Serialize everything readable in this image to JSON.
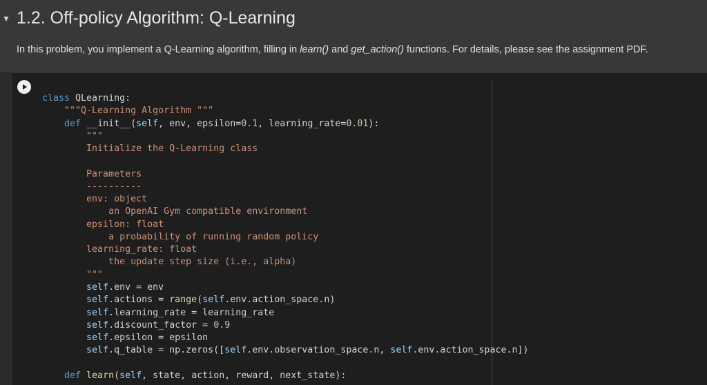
{
  "section": {
    "title": "1.2. Off-policy Algorithm: Q-Learning",
    "desc_parts": [
      "In this problem, you implement a Q-Learning algorithm, filling in ",
      "learn()",
      " and ",
      "get_action()",
      " functions. For details, please see the assignment PDF."
    ]
  },
  "colors": {
    "keyword": "#569cd6",
    "string": "#ce9178",
    "self": "#9cdcfe",
    "number": "#b5cea8",
    "function": "#dcdcaa",
    "text": "#d4d4d4"
  },
  "code_lines": [
    [
      [
        "class",
        "kw"
      ],
      [
        " QLearning:",
        "tx"
      ]
    ],
    [
      [
        "    \"\"\"Q-Learning Algorithm \"\"\"",
        "str"
      ]
    ],
    [
      [
        "    def",
        "kw"
      ],
      [
        " __init__(",
        "tx"
      ],
      [
        "self",
        "self"
      ],
      [
        ", env, epsilon=",
        "tx"
      ],
      [
        "0.1",
        "num"
      ],
      [
        ", learning_rate=",
        "tx"
      ],
      [
        "0.01",
        "num"
      ],
      [
        "):",
        "tx"
      ]
    ],
    [
      [
        "        \"\"\"",
        "str"
      ]
    ],
    [
      [
        "        Initialize the Q-Learning class",
        "str"
      ]
    ],
    [
      [
        "",
        "tx"
      ]
    ],
    [
      [
        "        Parameters",
        "str"
      ]
    ],
    [
      [
        "        ----------",
        "str"
      ]
    ],
    [
      [
        "        env: object",
        "str"
      ]
    ],
    [
      [
        "            an OpenAI Gym compatible environment",
        "str"
      ]
    ],
    [
      [
        "        epsilon: float",
        "str"
      ]
    ],
    [
      [
        "            a probability of running random policy",
        "str"
      ]
    ],
    [
      [
        "        learning_rate: float",
        "str"
      ]
    ],
    [
      [
        "            the update step size (i.e., alpha)",
        "str"
      ]
    ],
    [
      [
        "        \"\"\"",
        "str"
      ]
    ],
    [
      [
        "        ",
        "tx"
      ],
      [
        "self",
        "self"
      ],
      [
        ".env = env",
        "tx"
      ]
    ],
    [
      [
        "        ",
        "tx"
      ],
      [
        "self",
        "self"
      ],
      [
        ".actions = ",
        "tx"
      ],
      [
        "range",
        "fn"
      ],
      [
        "(",
        "tx"
      ],
      [
        "self",
        "self"
      ],
      [
        ".env.action_space.n)",
        "tx"
      ]
    ],
    [
      [
        "        ",
        "tx"
      ],
      [
        "self",
        "self"
      ],
      [
        ".learning_rate = learning_rate",
        "tx"
      ]
    ],
    [
      [
        "        ",
        "tx"
      ],
      [
        "self",
        "self"
      ],
      [
        ".discount_factor = ",
        "tx"
      ],
      [
        "0.9",
        "num"
      ]
    ],
    [
      [
        "        ",
        "tx"
      ],
      [
        "self",
        "self"
      ],
      [
        ".epsilon = epsilon",
        "tx"
      ]
    ],
    [
      [
        "        ",
        "tx"
      ],
      [
        "self",
        "self"
      ],
      [
        ".q_table = np.zeros([",
        "tx"
      ],
      [
        "self",
        "self"
      ],
      [
        ".env.observation_space.n, ",
        "tx"
      ],
      [
        "self",
        "self"
      ],
      [
        ".env.action_space.n])",
        "tx"
      ]
    ],
    [
      [
        "",
        "tx"
      ]
    ],
    [
      [
        "    def",
        "kw"
      ],
      [
        " ",
        "tx"
      ],
      [
        "learn",
        "fn"
      ],
      [
        "(",
        "tx"
      ],
      [
        "self",
        "self"
      ],
      [
        ", state, action, reward, next_state):",
        "tx"
      ]
    ]
  ]
}
